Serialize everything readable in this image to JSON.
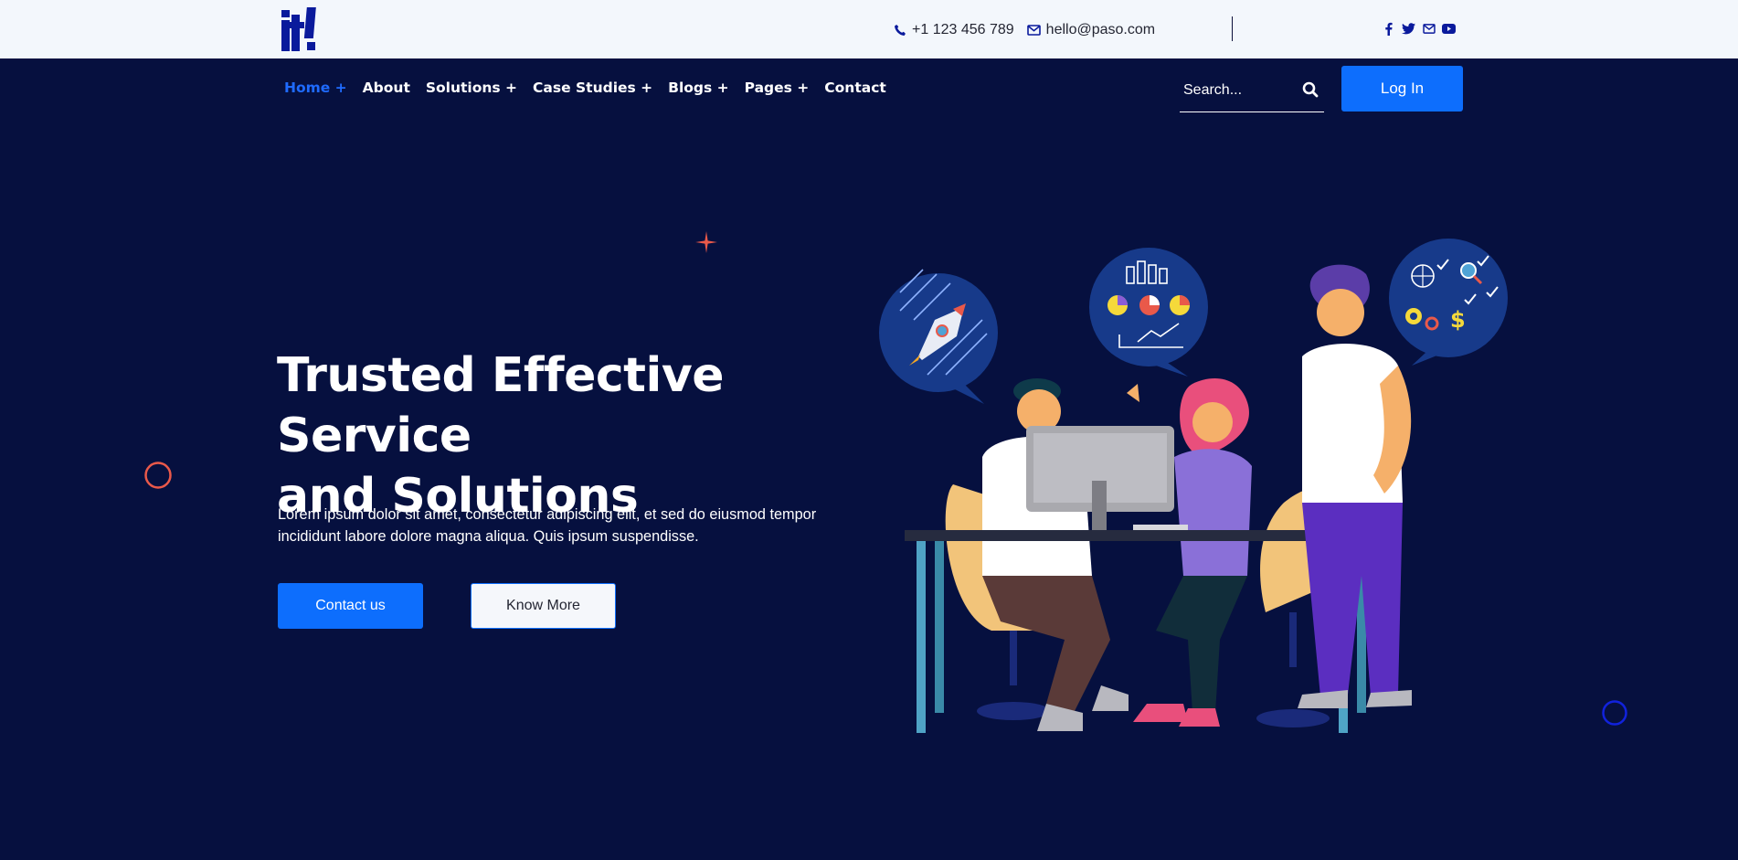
{
  "topbar": {
    "logo_text": "it!",
    "phone": "+1 123 456 789",
    "email": "hello@paso.com",
    "social_icons": [
      "facebook-icon",
      "twitter-icon",
      "envelope-icon",
      "youtube-icon"
    ]
  },
  "nav": {
    "items": [
      {
        "label": "Home +",
        "active": true
      },
      {
        "label": "About"
      },
      {
        "label": "Solutions +"
      },
      {
        "label": "Case Studies +"
      },
      {
        "label": "Blogs +"
      },
      {
        "label": "Pages +"
      },
      {
        "label": "Contact"
      }
    ],
    "search_placeholder": "Search...",
    "login_label": "Log In"
  },
  "hero": {
    "title_line1": "Trusted Effective Service",
    "title_line2": "and Solutions",
    "text": "Lorem ipsum dolor sit amet, consectetur adipiscing elit, et sed do eiusmod tempor incididunt labore dolore magna aliqua. Quis ipsum suspendisse.",
    "primary_button": "Contact us",
    "secondary_button": "Know More"
  },
  "colors": {
    "background": "#06103f",
    "topbar": "#f3f7fc",
    "accent": "#0d6efd",
    "active_nav": "#1f6bff",
    "deco_orange": "#e9594a",
    "deco_blue": "#1122dd"
  }
}
